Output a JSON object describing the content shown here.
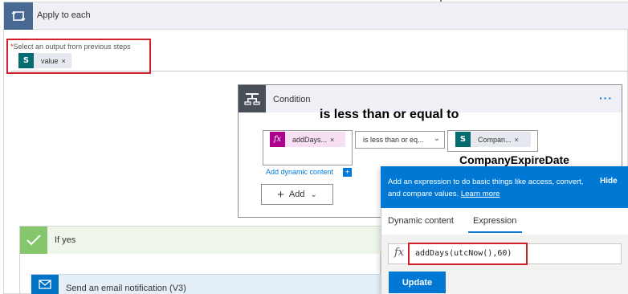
{
  "apply_each": {
    "title": "Apply to each",
    "select_required_mark": "*",
    "select_label": "Select an output from previous steps",
    "token": {
      "label": "value",
      "remove": "×",
      "icon": "sharepoint-icon"
    }
  },
  "condition": {
    "title": "Condition",
    "more": "···",
    "left_token": {
      "label": "addDays...",
      "remove": "×",
      "icon": "fx-icon"
    },
    "operator": "is less than or eq...",
    "right_token": {
      "label": "Compan...",
      "remove": "×",
      "icon": "sharepoint-icon"
    },
    "add_dynamic": "Add dynamic content",
    "add_dynamic_plus": "+",
    "add_button": "Add",
    "add_plus": "+"
  },
  "annotations": {
    "operator_note": "is less than or equal to",
    "column_note": "CompanyExpireDate"
  },
  "if_yes": {
    "title": "If yes",
    "email_action": "Send an email notification (V3)"
  },
  "flyout": {
    "description": "Add an expression to do basic things like access, convert, and compare values.",
    "learn_more": "Learn more",
    "hide": "Hide",
    "tabs": [
      "Dynamic content",
      "Expression"
    ],
    "active_tab": "Expression",
    "fx_symbol": "fx",
    "expression": "addDays(utcNow(),60)",
    "update_button": "Update"
  },
  "colors": {
    "accent": "#0078d4",
    "highlight_red": "#d0202a",
    "sharepoint": "#036c70",
    "expression_token": "#ad008c",
    "condition_icon": "#484f58",
    "apply_icon": "#486991",
    "yes_icon": "#85c56b",
    "mail_icon": "#0072c6"
  }
}
